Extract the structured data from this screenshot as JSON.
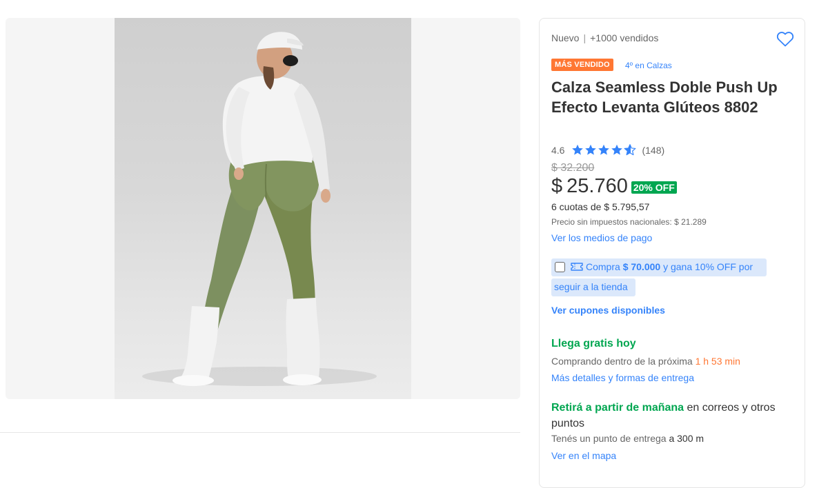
{
  "product": {
    "condition": "Nuevo",
    "sold": "+1000 vendidos",
    "badge": "MÁS VENDIDO",
    "rank": "4º en Calzas",
    "title": "Calza Seamless Doble Push Up Efecto Levanta Glúteos 8802",
    "rating": {
      "value": "4.6",
      "count": "(148)",
      "stars": 4.6
    },
    "image_alt": "Calza Seamless Doble Push Up verde"
  },
  "price": {
    "original": "$ 32.200",
    "currency": "$",
    "amount": "25.760",
    "discount": "20% OFF",
    "installments": "6 cuotas de $ 5.795,57",
    "tax_note": "Precio sin impuestos nacionales: $ 21.289",
    "payment_link": "Ver los medios de pago"
  },
  "coupon": {
    "prefix": "Compra ",
    "amount": "$ 70.000",
    "suffix": " y gana 10% OFF por",
    "line2": "seguir a la tienda",
    "checked": false,
    "link": "Ver cupones disponibles"
  },
  "shipping": {
    "title": "Llega gratis hoy",
    "sub_prefix": "Comprando dentro de la próxima ",
    "time": "1 h 53 min",
    "link": "Más detalles y formas de entrega"
  },
  "pickup": {
    "title": "Retirá a partir de mañana",
    "rest": " en correos y otros puntos",
    "point_prefix": "Tenés un punto de entrega ",
    "distance": "a 300 m",
    "map_link": "Ver en el mapa"
  },
  "colors": {
    "link": "#3483fa",
    "green": "#00a650",
    "orange": "#ff7733",
    "coupon_bg": "#dbe8fb"
  },
  "icons": [
    "heart-icon",
    "star-icon",
    "half-star-icon",
    "coupon-ticket-icon"
  ]
}
